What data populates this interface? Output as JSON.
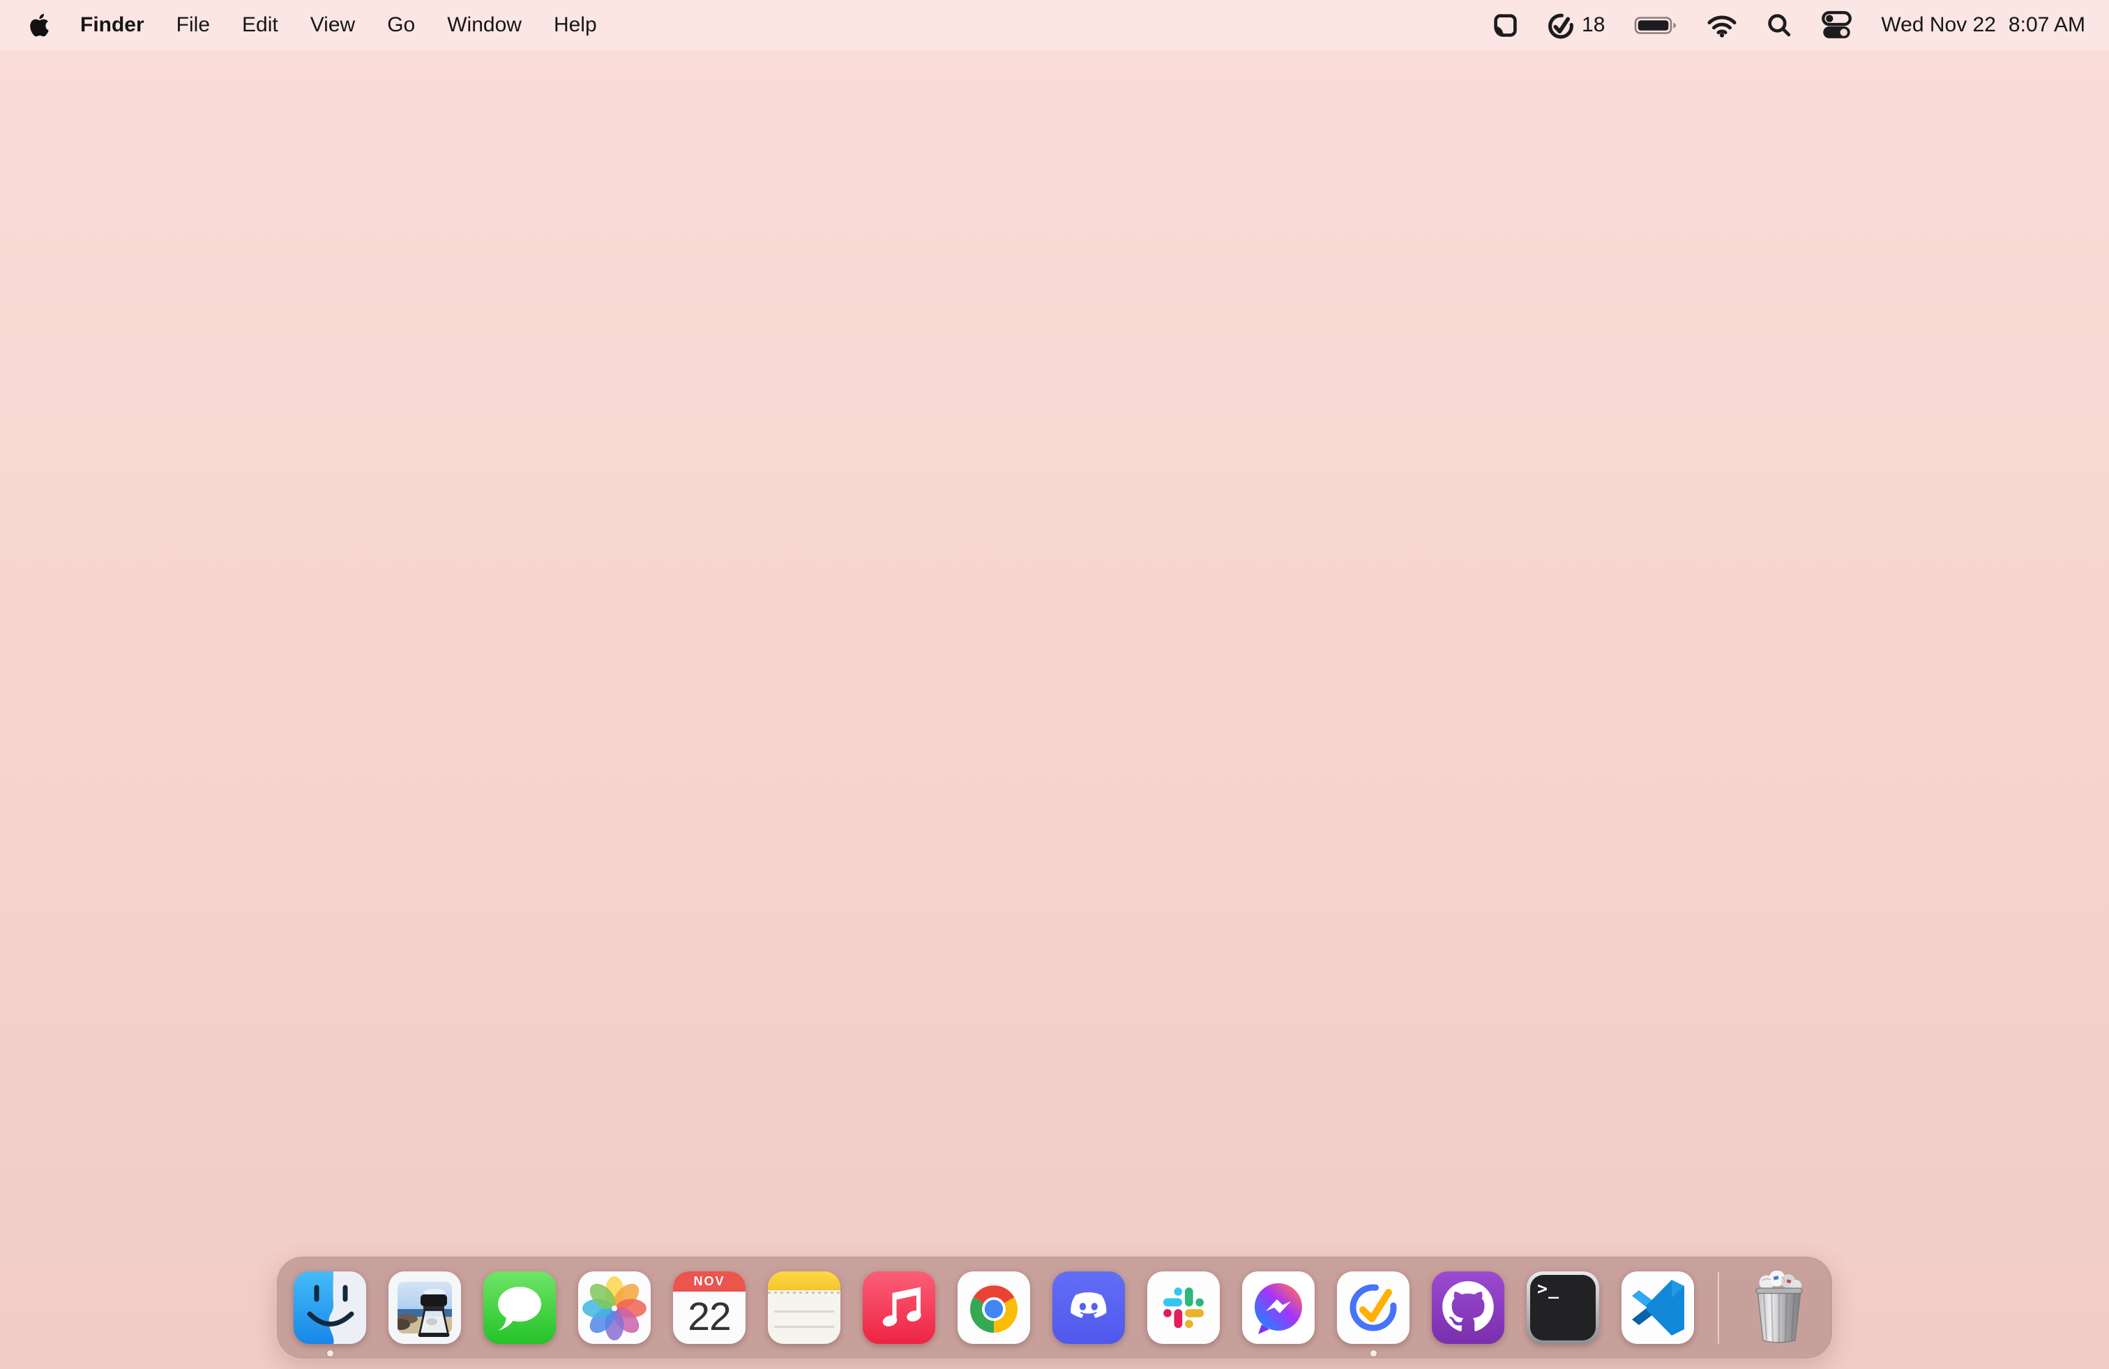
{
  "menubar": {
    "app_name": "Finder",
    "menus": [
      "File",
      "Edit",
      "View",
      "Go",
      "Window",
      "Help"
    ],
    "status": {
      "task_count": "18",
      "date": "Wed Nov 22",
      "time": "8:07 AM"
    }
  },
  "dock": {
    "apps": [
      {
        "name": "Finder",
        "running": true
      },
      {
        "name": "Preview",
        "running": false
      },
      {
        "name": "Messages",
        "running": false
      },
      {
        "name": "Photos",
        "running": false
      },
      {
        "name": "Calendar",
        "running": false
      },
      {
        "name": "Notes",
        "running": false
      },
      {
        "name": "Music",
        "running": false
      },
      {
        "name": "Google Chrome",
        "running": false
      },
      {
        "name": "Discord",
        "running": false
      },
      {
        "name": "Slack",
        "running": false
      },
      {
        "name": "Messenger",
        "running": false
      },
      {
        "name": "TickTick",
        "running": true
      },
      {
        "name": "GitHub Desktop",
        "running": false
      },
      {
        "name": "Terminal",
        "running": false
      },
      {
        "name": "Visual Studio Code",
        "running": false
      }
    ],
    "calendar_icon": {
      "month": "NOV",
      "day": "22"
    },
    "terminal_glyph": ">_",
    "trash": {
      "name": "Trash",
      "state": "full"
    }
  },
  "colors": {
    "wallpaper_top": "#f9dcd8",
    "wallpaper_bottom": "#f1ccc6",
    "dock_tint": "rgba(123,78,74,0.35)",
    "calendar_red": "#ec544e",
    "ticktick_blue": "#4772fa",
    "ticktick_check": "#ffb005"
  }
}
